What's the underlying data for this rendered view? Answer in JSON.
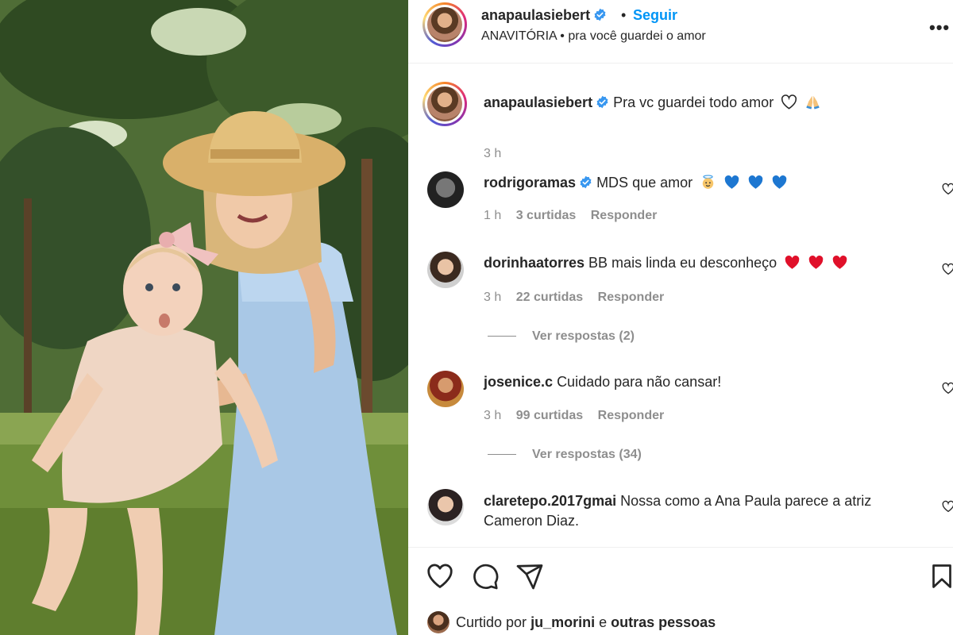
{
  "post": {
    "username": "anapaulasiebert",
    "separator": "•",
    "follow_label": "Seguir",
    "audio": "ANAVITÓRIA • pra você guardei o amor",
    "more_label": "•••"
  },
  "caption": {
    "username": "anapaulasiebert",
    "text": "Pra vc guardei todo amor",
    "time": "3 h"
  },
  "comments": [
    {
      "username": "rodrigoramas",
      "text": "MDS que amor",
      "time": "1 h",
      "likes": "3 curtidas",
      "reply": "Responder",
      "view_replies": ""
    },
    {
      "username": "dorinhaatorres",
      "text": "BB mais linda eu desconheço",
      "time": "3 h",
      "likes": "22 curtidas",
      "reply": "Responder",
      "view_replies": "Ver respostas (2)"
    },
    {
      "username": "josenice.c",
      "text": "Cuidado para não cansar!",
      "time": "3 h",
      "likes": "99 curtidas",
      "reply": "Responder",
      "view_replies": "Ver respostas (34)"
    },
    {
      "username": "claretepo.2017gmai",
      "text": "Nossa como a Ana Paula parece a atriz Cameron Diaz.",
      "time": "",
      "likes": "",
      "reply": "",
      "view_replies": ""
    }
  ],
  "likes_bar": {
    "prefix": "Curtido por",
    "user": "ju_morini",
    "conj": "e",
    "others": "outras pessoas"
  },
  "colors": {
    "link": "#0095f6",
    "secondary": "#8e8e8e",
    "text": "#262626",
    "verified": "#3897f0",
    "heart": "#ed4956",
    "blue_heart": "#1d77d1"
  },
  "icons": [
    "verified-badge-icon",
    "heart-outline-icon",
    "comment-icon",
    "share-icon",
    "bookmark-icon",
    "praying-hands-emoji",
    "angel-emoji",
    "blue-heart-emoji",
    "red-heart-emoji"
  ]
}
